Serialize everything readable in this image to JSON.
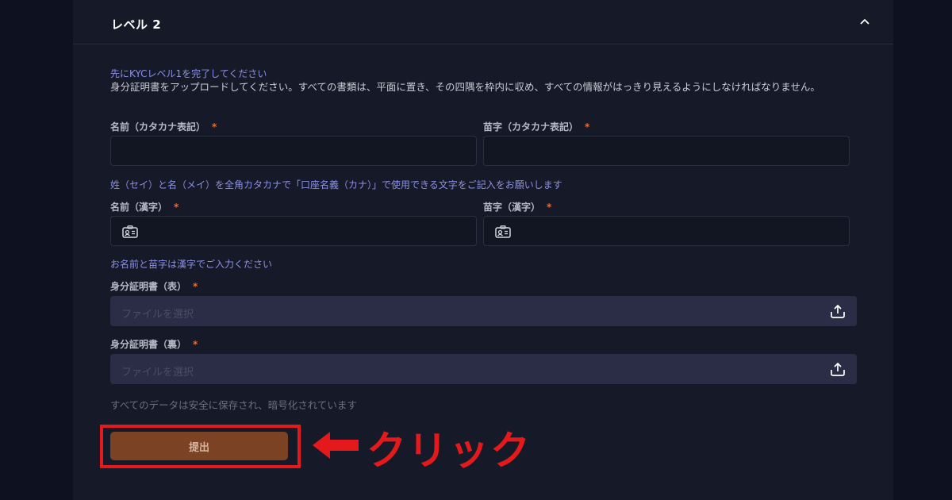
{
  "section": {
    "title": "レベル 2",
    "collapse_icon": "chevron-up-icon"
  },
  "notice": "先にKYCレベル1を完了してください",
  "description": "身分証明書をアップロードしてください。すべての書類は、平面に置き、その四隅を枠内に収め、すべての情報がはっきり見えるようにしなければなりません。",
  "fields": {
    "first_name_kana": {
      "label": "名前（カタカナ表記）",
      "required_mark": "*",
      "value": ""
    },
    "last_name_kana": {
      "label": "苗字（カタカナ表記）",
      "required_mark": "*",
      "value": ""
    },
    "kana_hint": "姓（セイ）と名（メイ）を全角カタカナで「口座名義（カナ）」で使用できる文字をご記入をお願いします",
    "first_name_kanji": {
      "label": "名前（漢字）",
      "required_mark": "*",
      "value": "",
      "icon": "id-card-icon"
    },
    "last_name_kanji": {
      "label": "苗字（漢字）",
      "required_mark": "*",
      "value": "",
      "icon": "id-card-icon"
    },
    "kanji_hint": "お名前と苗字は漢字でご入力ください",
    "id_front": {
      "label": "身分証明書（表）",
      "required_mark": "*",
      "placeholder": "ファイルを選択",
      "icon": "upload-icon"
    },
    "id_back": {
      "label": "身分証明書（裏）",
      "required_mark": "*",
      "placeholder": "ファイルを選択",
      "icon": "upload-icon"
    }
  },
  "security_note": "すべてのデータは安全に保存され、暗号化されています",
  "submit_label": "提出",
  "annotation": {
    "text": "クリック",
    "color": "#e3191b",
    "icon": "arrow-left-icon"
  },
  "colors": {
    "background": "#0e1220",
    "panel": "#161a28",
    "accent_note": "#8b8fe6",
    "required": "#f06a2a",
    "submit_button": "#7b4324"
  }
}
